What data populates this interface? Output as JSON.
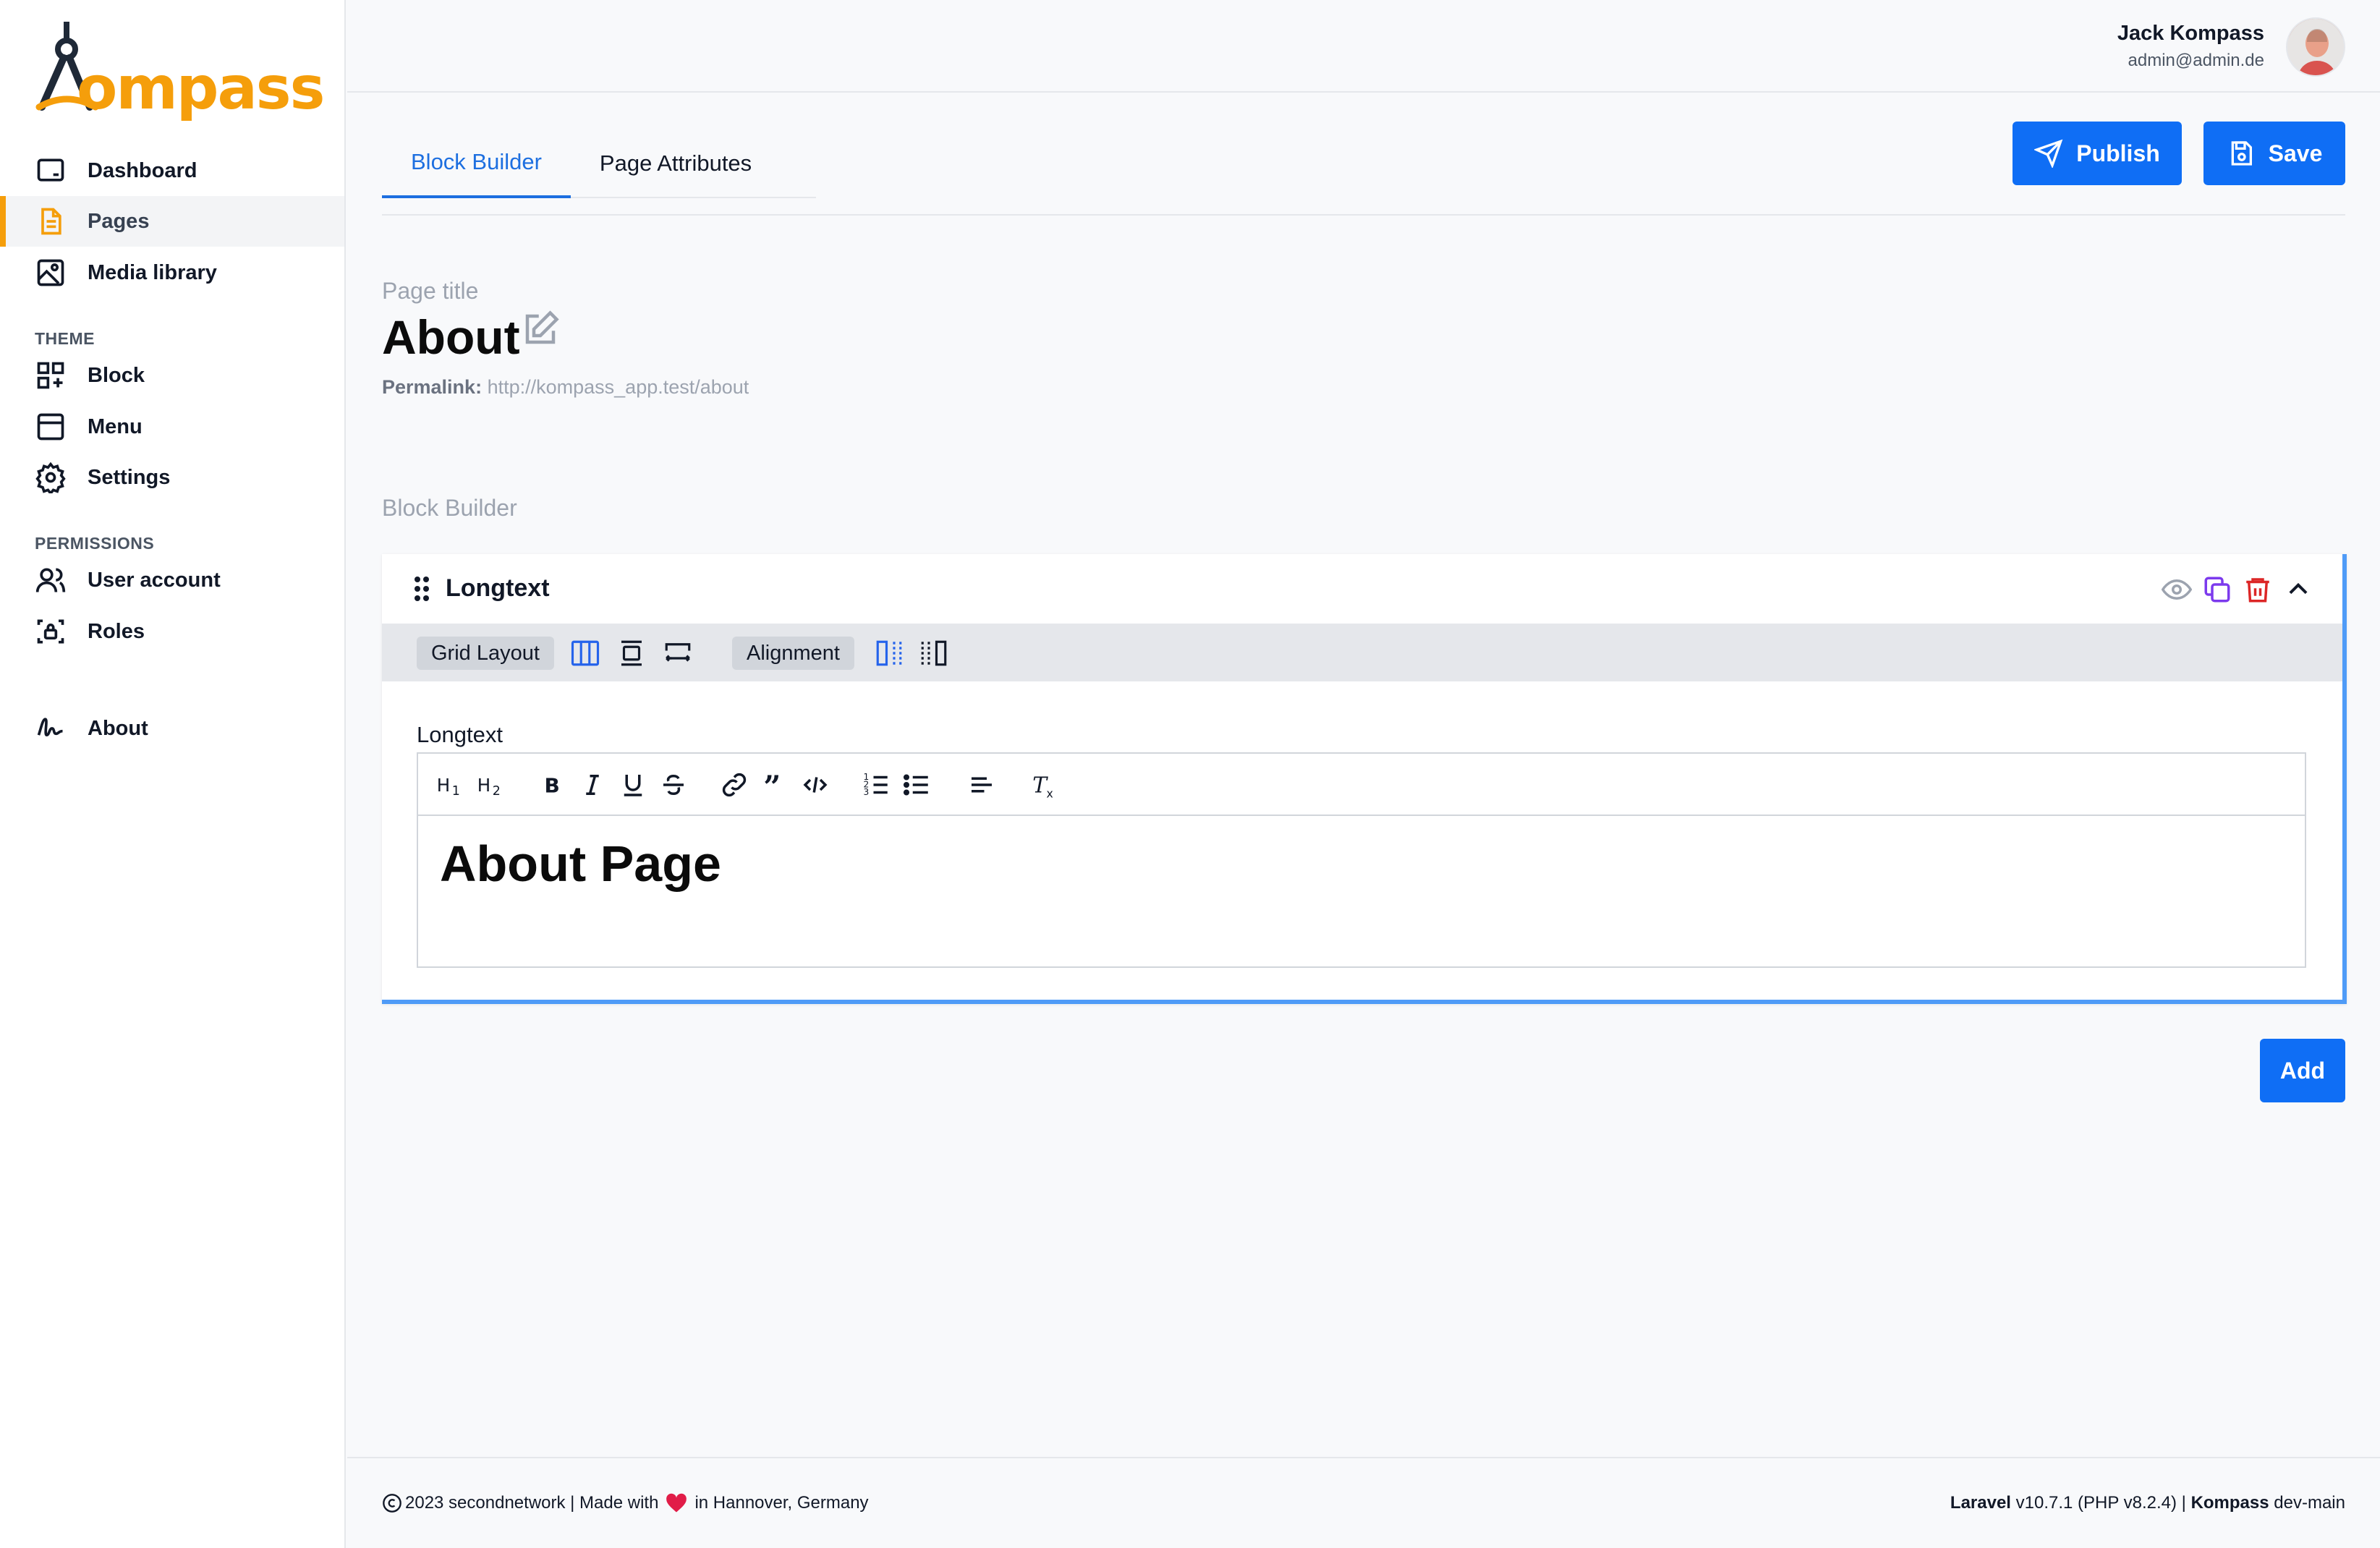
{
  "brand": {
    "logo_text_dark": "K",
    "logo_text_orange": "ompass",
    "accent_color": "#f59e0b",
    "primary_color": "#0f6ef5"
  },
  "sidebar": {
    "items": [
      {
        "label": "Dashboard",
        "icon": "dashboard-icon"
      },
      {
        "label": "Pages",
        "icon": "pages-icon",
        "active": true
      },
      {
        "label": "Media library",
        "icon": "image-icon"
      }
    ],
    "theme_heading": "THEME",
    "theme_items": [
      {
        "label": "Block",
        "icon": "blocks-icon"
      },
      {
        "label": "Menu",
        "icon": "menu-icon"
      },
      {
        "label": "Settings",
        "icon": "gear-icon"
      }
    ],
    "permissions_heading": "PERMISSIONS",
    "permission_items": [
      {
        "label": "User account",
        "icon": "users-icon"
      },
      {
        "label": "Roles",
        "icon": "roles-icon"
      }
    ],
    "about": {
      "label": "About",
      "icon": "signature-icon"
    }
  },
  "header": {
    "user_name": "Jack Kompass",
    "user_email": "admin@admin.de"
  },
  "tabs": [
    {
      "label": "Block Builder",
      "active": true
    },
    {
      "label": "Page Attributes",
      "active": false
    }
  ],
  "actions": {
    "publish_label": "Publish",
    "save_label": "Save",
    "add_label": "Add"
  },
  "page": {
    "title_label": "Page title",
    "title": "About",
    "permalink_label": "Permalink:",
    "permalink_url": "http://kompass_app.test/about"
  },
  "block_builder": {
    "section_label": "Block Builder",
    "block": {
      "title": "Longtext",
      "grid_layout_label": "Grid Layout",
      "alignment_label": "Alignment",
      "field_label": "Longtext",
      "content": "About Page"
    }
  },
  "footer": {
    "copyright": "2023 secondnetwork | Made with",
    "location": "in Hannover, Germany",
    "framework_name": "Laravel",
    "framework_version": "v10.7.1 (PHP v8.2.4) |",
    "app_name": "Kompass",
    "app_branch": "dev-main"
  }
}
